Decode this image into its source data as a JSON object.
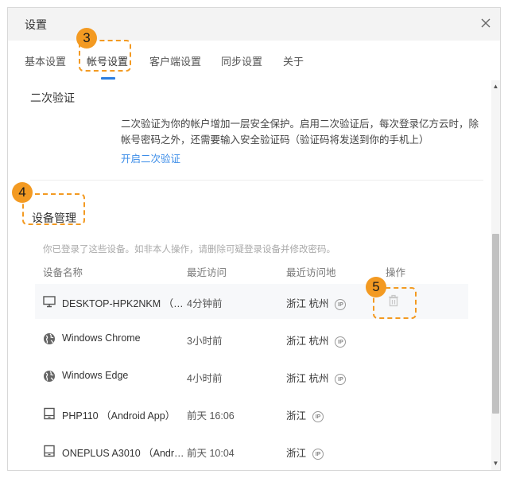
{
  "dialog": {
    "title": "设置"
  },
  "tabs": [
    {
      "label": "基本设置"
    },
    {
      "label": "帐号设置"
    },
    {
      "label": "客户端设置"
    },
    {
      "label": "同步设置"
    },
    {
      "label": "关于"
    }
  ],
  "two_factor": {
    "title": "二次验证",
    "description": "二次验证为你的帐户增加一层安全保护。启用二次验证后，每次登录亿方云时，除帐号密码之外，还需要输入安全验证码（验证码将发送到你的手机上）",
    "enable_link": "开启二次验证"
  },
  "device_mgmt": {
    "title": "设备管理",
    "hint": "你已登录了这些设备。如非本人操作，请删除可疑登录设备并修改密码。",
    "columns": {
      "name": "设备名称",
      "recent": "最近访问",
      "location": "最近访问地",
      "action": "操作"
    },
    "ip_label": "IP",
    "devices": [
      {
        "name": "DESKTOP-HPK2NKM （W...",
        "recent": "4分钟前",
        "location": "浙江 杭州",
        "icon": "monitor-icon"
      },
      {
        "name": "Windows Chrome",
        "recent": "3小时前",
        "location": "浙江 杭州",
        "icon": "globe-icon"
      },
      {
        "name": "Windows Edge",
        "recent": "4小时前",
        "location": "浙江 杭州",
        "icon": "globe-icon"
      },
      {
        "name": "PHP110 （Android App）",
        "recent": "前天 16:06",
        "location": "浙江",
        "icon": "tablet-icon"
      },
      {
        "name": "ONEPLUS A3010 （Androi...",
        "recent": "前天 10:04",
        "location": "浙江",
        "icon": "tablet-icon"
      }
    ]
  },
  "annotations": {
    "badge3": "3",
    "badge4": "4",
    "badge5": "5"
  },
  "colors": {
    "accent": "#2a7de1",
    "link": "#3b8ce8",
    "annotation": "#f39a22"
  }
}
